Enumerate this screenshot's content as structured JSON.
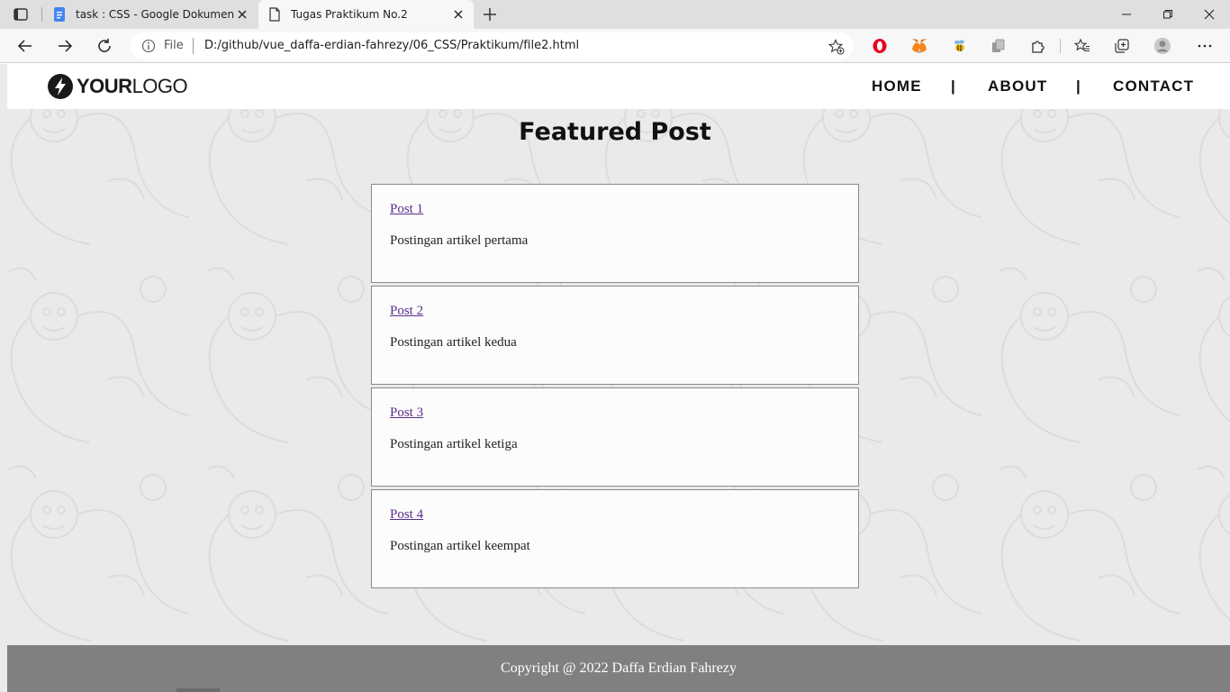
{
  "browser": {
    "tabs": [
      {
        "title": "task : CSS - Google Dokumen",
        "icon": "google-docs-icon"
      },
      {
        "title": "Tugas Praktikum No.2",
        "icon": "page-icon",
        "active": true
      }
    ],
    "address": {
      "scheme_label": "File",
      "url": "D:/github/vue_daffa-erdian-fahrezy/06_CSS/Praktikum/file2.html"
    },
    "extensions": [
      "opera-icon",
      "metamask-icon",
      "bee-icon",
      "copy-icon",
      "puzzle-icon",
      "favorites-icon",
      "collections-icon",
      "profile-icon",
      "more-icon"
    ]
  },
  "site": {
    "logo": {
      "bold": "YOUR",
      "regular": "LOGO"
    },
    "nav": {
      "items": [
        "HOME",
        "ABOUT",
        "CONTACT"
      ],
      "separator": "|"
    },
    "heading": "Featured Post",
    "posts": [
      {
        "title": "Post 1",
        "body": "Postingan artikel pertama"
      },
      {
        "title": "Post 2",
        "body": "Postingan artikel kedua"
      },
      {
        "title": "Post 3",
        "body": "Postingan artikel ketiga"
      },
      {
        "title": "Post 4",
        "body": "Postingan artikel keempat"
      }
    ],
    "footer": "Copyright @ 2022 Daffa Erdian Fahrezy"
  },
  "colors": {
    "page_bg": "#eaeaea",
    "footer_bg": "#808080",
    "link": "#5a2d8c"
  }
}
